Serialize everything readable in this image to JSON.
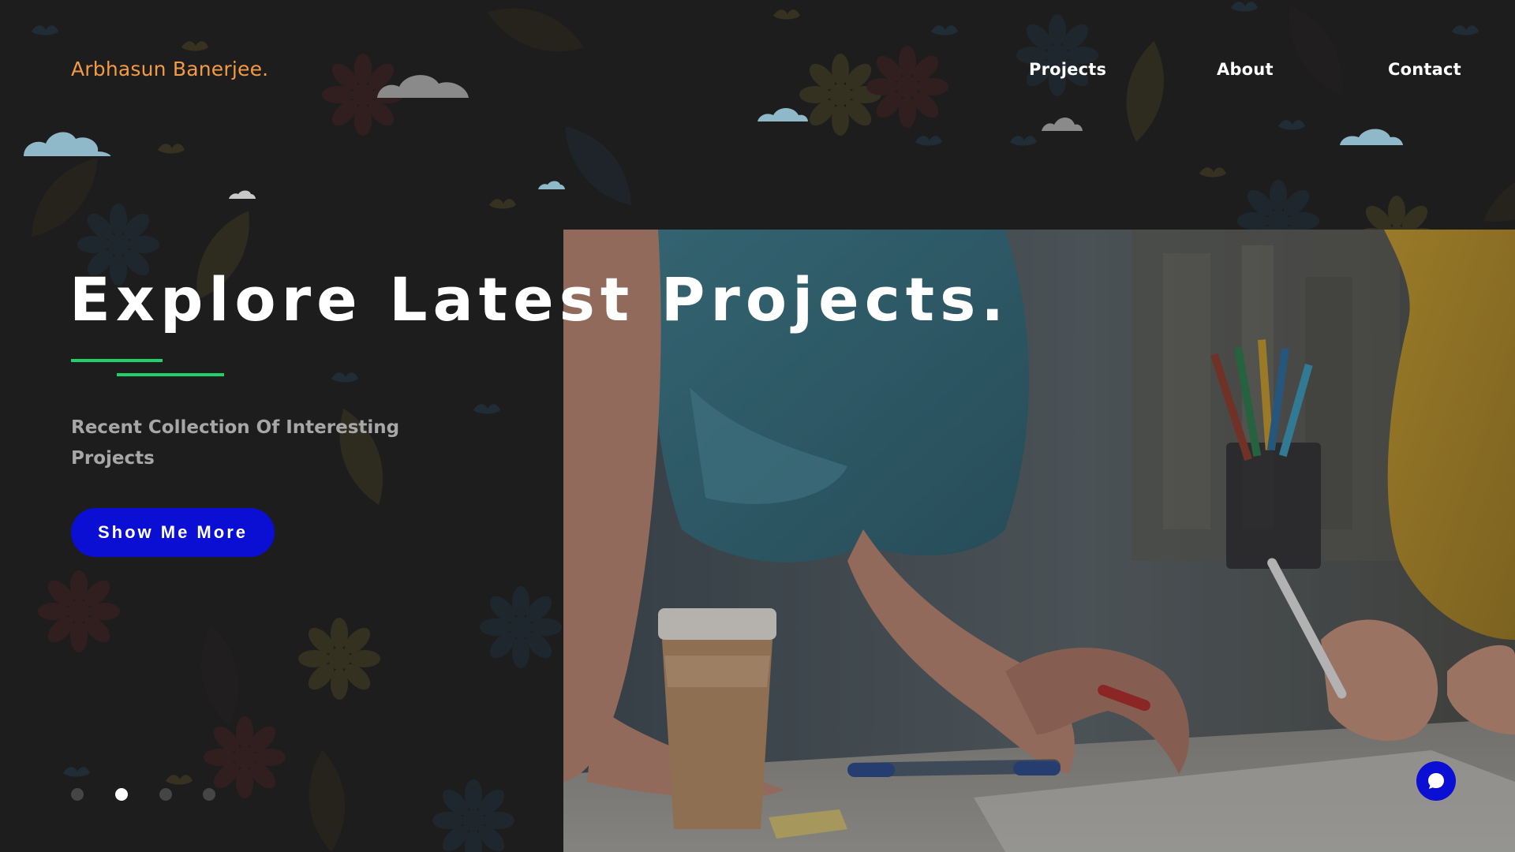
{
  "header": {
    "brand": "Arbhasun Banerjee.",
    "nav": [
      {
        "label": "Projects"
      },
      {
        "label": "About"
      },
      {
        "label": "Contact"
      }
    ]
  },
  "hero": {
    "title": "Explore Latest Projects.",
    "subtitle": "Recent Collection Of Interesting Projects",
    "cta_label": "Show Me More"
  },
  "slider": {
    "total": 4,
    "active_index": 2
  },
  "colors": {
    "background": "#1d1d1e",
    "brand": "#f29a45",
    "accent_line": "#1fd16a",
    "button": "#0a0fd3",
    "text_primary": "#ffffff",
    "text_secondary": "#a7a7a7"
  },
  "icons": {
    "chat": "chat-bubble-icon",
    "cloud": "cloud-icon"
  }
}
